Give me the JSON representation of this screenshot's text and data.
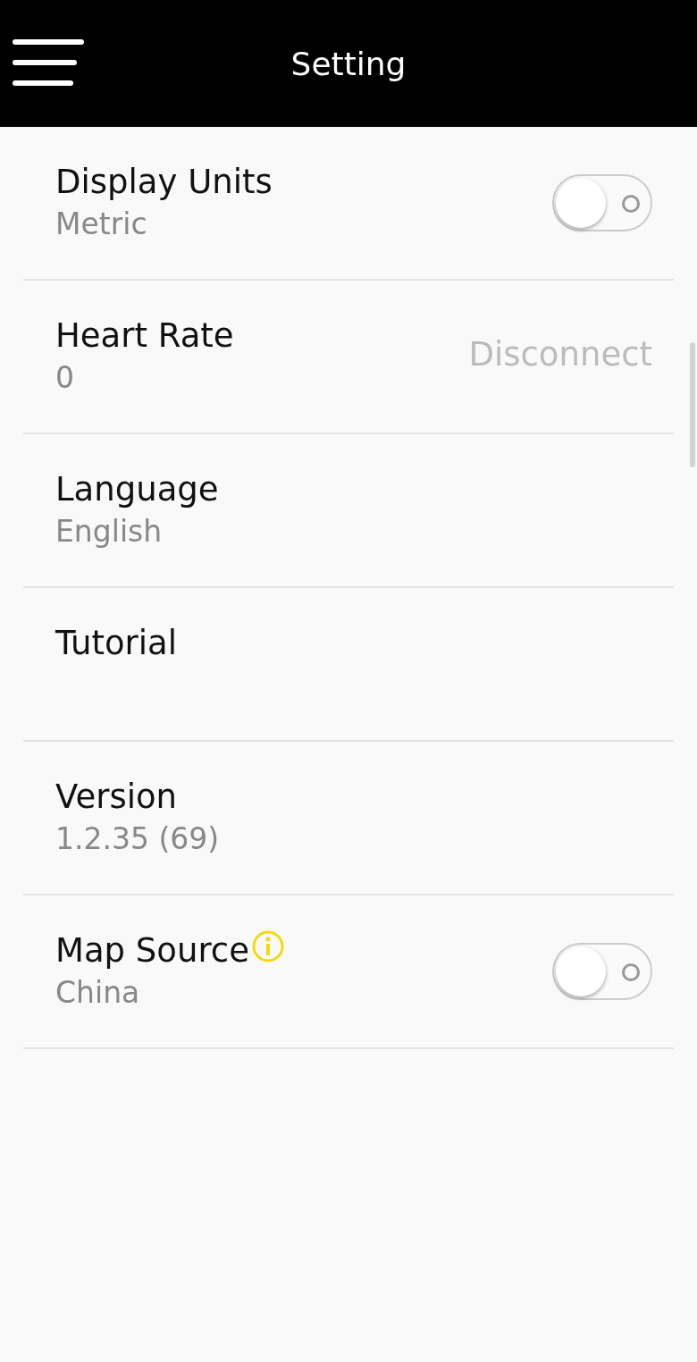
{
  "header": {
    "title": "Setting"
  },
  "settings": [
    {
      "kind": "toggle",
      "label": "Display Units",
      "value": "Metric",
      "on": false
    },
    {
      "kind": "action",
      "label": "Heart Rate",
      "value": "0",
      "action": "Disconnect"
    },
    {
      "kind": "plain",
      "label": "Language",
      "value": "English"
    },
    {
      "kind": "plain",
      "label": "Tutorial"
    },
    {
      "kind": "plain",
      "label": "Version",
      "value": "1.2.35 (69)"
    },
    {
      "kind": "toggle",
      "label": "Map Source",
      "value": "China",
      "on": false,
      "info": true
    }
  ]
}
